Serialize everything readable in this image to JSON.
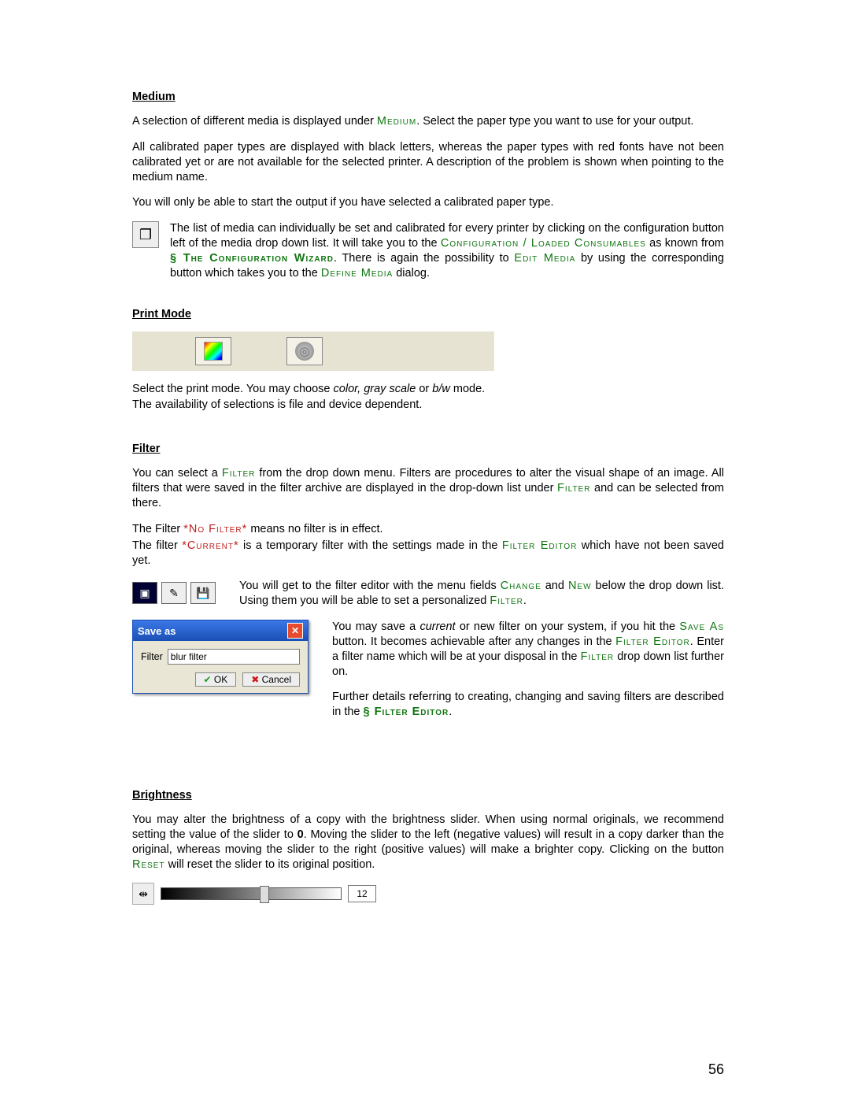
{
  "sections": {
    "medium_h": "Medium",
    "printmode_h": "Print Mode",
    "filter_h": "Filter",
    "brightness_h": "Brightness"
  },
  "medium": {
    "p1a": "A selection of different media is displayed under ",
    "p1_sc": "Medium",
    "p1b": ". Select the paper type you want to use for your output.",
    "p2": "All calibrated paper types are displayed with black letters, whereas the paper types with red fonts have not been calibrated yet or are not available for the selected printer. A description of the problem is shown when pointing to the medium name.",
    "p3": "You will only be able to start the output if you have selected a calibrated paper type.",
    "p4a": "The list of media can individually be set and calibrated for every printer by clicking on the configuration button left of the media drop down list. It will take you to the ",
    "p4_green1": "Configuration / Loaded Consumables",
    "p4b": " as known from ",
    "p4_green2": "§ The Configuration Wizard",
    "p4c": ". There is again the possibility to ",
    "p4_green3": "Edit Media",
    "p4d": " by using the corresponding button which takes you to the ",
    "p4_green4": "Define Media",
    "p4e": " dialog."
  },
  "printmode": {
    "p1a": "Select the print mode. You may choose ",
    "p1_i": "color, gray scale",
    "p1b": " or ",
    "p1_i2": "b/w",
    "p1c": " mode.",
    "p2": "The availability of selections is file and device dependent."
  },
  "filter": {
    "p1a": "You can select a ",
    "p1_green": "Filter",
    "p1b": " from the drop down menu. Filters are procedures to alter the visual shape of an image. All filters that were saved in the filter archive are displayed in the drop-down list under ",
    "p1_green2": "Filter",
    "p1c": " and can be selected from there.",
    "p2a": "The Filter ",
    "p2_red": "*No Filter*",
    "p2b": " means no filter is in effect.",
    "p3a": "The filter ",
    "p3_red": "*Current*",
    "p3b": " is a temporary filter with the settings made in the ",
    "p3_green": "Filter Editor",
    "p3c": " which have not been saved yet.",
    "p4a": "You will get to the filter editor with the menu fields ",
    "p4_g1": "Change",
    "p4b": " and ",
    "p4_g2": "New",
    "p4c": " below the drop down list. Using them you will be able to set a personalized ",
    "p4_g3": "Filter",
    "p4d": ".",
    "p5a": "You may save a ",
    "p5_i": "current",
    "p5b": " or new filter on your system, if you hit the ",
    "p5_g1": "Save As",
    "p5c": " button. It becomes achievable after any changes in the ",
    "p5_g2": "Filter Editor",
    "p5d": ". Enter a filter name which will be at your disposal in the ",
    "p5_g3": "Filter",
    "p5e": " drop down list further on.",
    "p6a": "Further details referring to creating, changing and saving filters are described in the ",
    "p6_g": "§ Filter Editor",
    "p6b": "."
  },
  "saveas": {
    "title": "Save as",
    "label": "Filter",
    "value": "blur filter",
    "ok": "OK",
    "cancel": "Cancel"
  },
  "brightness": {
    "p1a": "You may alter the brightness of a copy with the brightness slider. When using normal originals, we recommend setting the value of the slider to ",
    "p1_b": "0",
    "p1b": ". Moving the slider to the left (negative values) will result in a copy darker than the original, whereas moving the slider to the right (positive values) will make a brighter copy. Clicking on the button ",
    "p1_g": "Reset",
    "p1c": " will reset the slider to its original position.",
    "value": "12"
  },
  "pagenum": "56"
}
